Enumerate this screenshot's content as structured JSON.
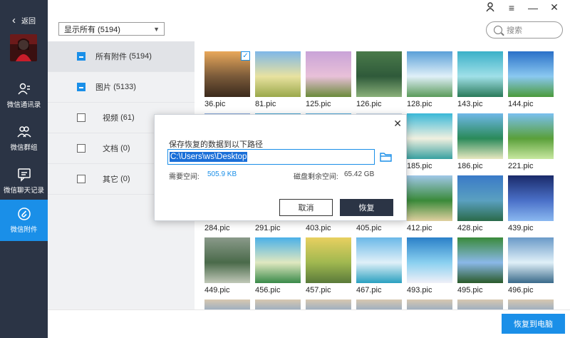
{
  "nav": {
    "back_label": "返回",
    "items": [
      {
        "label": "微信通讯录",
        "icon": "contacts-icon"
      },
      {
        "label": "微信群组",
        "icon": "group-icon"
      },
      {
        "label": "微信聊天记录",
        "icon": "chat-icon"
      },
      {
        "label": "微信附件",
        "icon": "attachment-icon"
      }
    ],
    "active_index": 3
  },
  "window_controls": [
    "user-icon",
    "menu-icon",
    "minimize-icon",
    "close-icon"
  ],
  "filter": {
    "selected": "显示所有 (5194)"
  },
  "search": {
    "placeholder": "搜索"
  },
  "categories": [
    {
      "label": "所有附件",
      "count": "(5194)",
      "checked": "partial"
    },
    {
      "label": "图片",
      "count": "(5133)",
      "checked": "partial"
    },
    {
      "label": "视频",
      "count": "(61)",
      "checked": "none"
    },
    {
      "label": "文档",
      "count": "(0)",
      "checked": "none"
    },
    {
      "label": "其它",
      "count": "(0)",
      "checked": "none"
    }
  ],
  "thumbnails": [
    {
      "name": "36.pic",
      "checked": true
    },
    {
      "name": "81.pic"
    },
    {
      "name": "125.pic"
    },
    {
      "name": "126.pic"
    },
    {
      "name": "128.pic"
    },
    {
      "name": "143.pic"
    },
    {
      "name": "144.pic"
    },
    {
      "name": ""
    },
    {
      "name": ""
    },
    {
      "name": ""
    },
    {
      "name": ""
    },
    {
      "name": "185.pic"
    },
    {
      "name": "186.pic"
    },
    {
      "name": "221.pic"
    },
    {
      "name": "284.pic"
    },
    {
      "name": "291.pic"
    },
    {
      "name": "403.pic"
    },
    {
      "name": "405.pic"
    },
    {
      "name": "412.pic"
    },
    {
      "name": "428.pic"
    },
    {
      "name": "439.pic"
    },
    {
      "name": "449.pic"
    },
    {
      "name": "456.pic"
    },
    {
      "name": "457.pic"
    },
    {
      "name": "467.pic"
    },
    {
      "name": "493.pic"
    },
    {
      "name": "495.pic"
    },
    {
      "name": "496.pic"
    }
  ],
  "bottom": {
    "restore_to_pc": "恢复到电脑"
  },
  "modal": {
    "title": "保存恢复的数据到以下路径",
    "path": "C:\\Users\\ws\\Desktop",
    "required_label": "需要空间:",
    "required_value": "505.9 KB",
    "disk_label": "磁盘剩余空间:",
    "disk_value": "65.42 GB",
    "cancel": "取消",
    "confirm": "恢复"
  },
  "colors": {
    "accent": "#1a8fe8",
    "nav_bg": "#2b3445"
  }
}
